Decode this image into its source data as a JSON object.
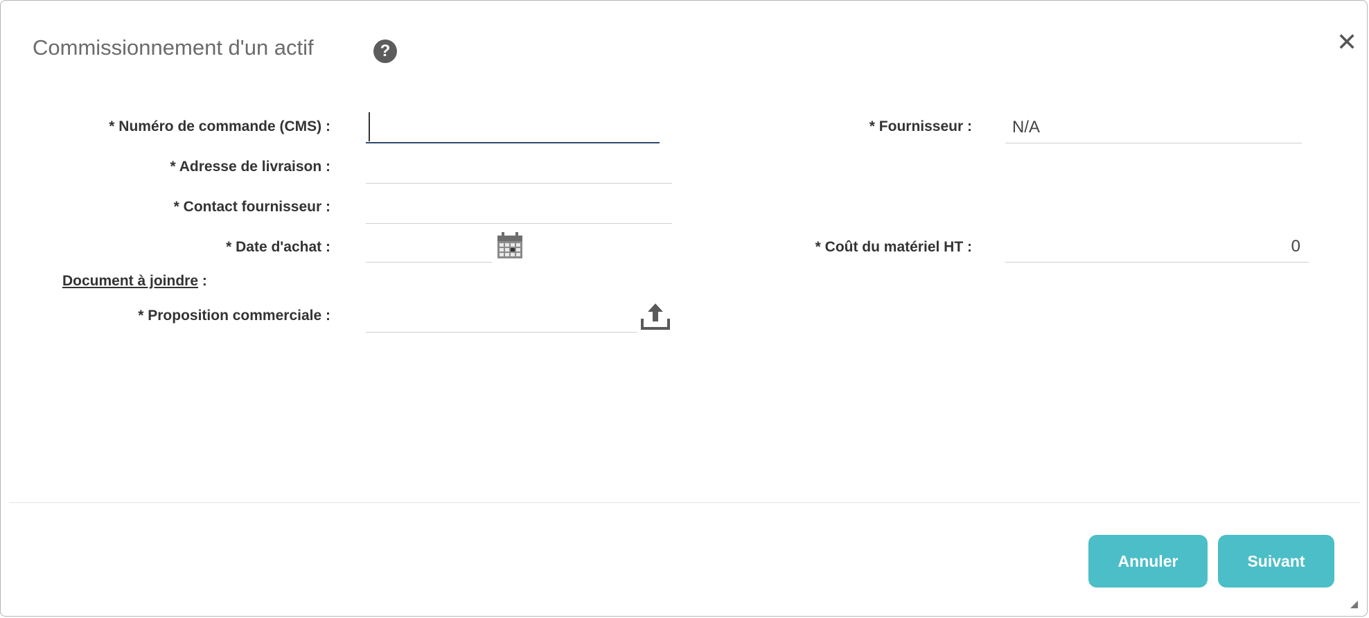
{
  "dialog": {
    "title": "Commissionnement d'un actif",
    "help_glyph": "?",
    "close_glyph": "✕"
  },
  "form": {
    "order_number": {
      "label": "* Numéro de commande (CMS) :",
      "value": ""
    },
    "delivery_address": {
      "label": "* Adresse de livraison :",
      "value": ""
    },
    "supplier_contact": {
      "label": "* Contact fournisseur :",
      "value": ""
    },
    "purchase_date": {
      "label": "* Date d'achat :",
      "value": ""
    },
    "supplier": {
      "label": "* Fournisseur :",
      "value": "N/A"
    },
    "hardware_cost": {
      "label": "* Coût du matériel HT :",
      "value": "0"
    },
    "attachment_section": {
      "title": "Document à joindre",
      "suffix": " :"
    },
    "commercial_proposal": {
      "label": "* Proposition commerciale :",
      "value": ""
    }
  },
  "footer": {
    "cancel_label": "Annuler",
    "next_label": "Suivant"
  },
  "icons": {
    "help": "help-icon",
    "close": "close-icon",
    "calendar": "calendar-icon",
    "upload": "upload-icon",
    "resize": "resize-grip-icon"
  },
  "colors": {
    "accent": "#4bbec8",
    "title_text": "#6b6b6b",
    "active_field_border": "#2d4a6b"
  }
}
